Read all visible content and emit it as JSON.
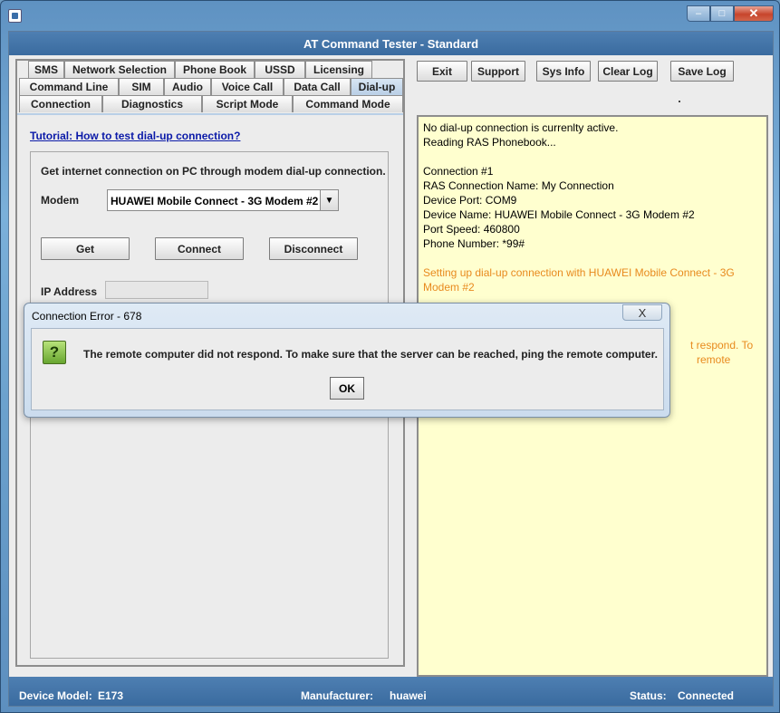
{
  "window": {
    "title": "AT Command Tester - Standard",
    "minimize_icon": "minimize-icon",
    "maximize_icon": "maximize-icon",
    "close_icon": "close-icon"
  },
  "tabs": {
    "row1": [
      "SMS",
      "Network Selection",
      "Phone Book",
      "USSD",
      "Licensing"
    ],
    "row2": [
      "Command Line",
      "SIM",
      "Audio",
      "Voice Call",
      "Data Call",
      "Dial-up"
    ],
    "row3": [
      "Connection",
      "Diagnostics",
      "Script Mode",
      "Command Mode"
    ],
    "active": "Dial-up"
  },
  "dialup": {
    "tutorial_link": "Tutorial: How to test dial-up connection?",
    "description": "Get internet connection on PC through modem dial-up connection.",
    "modem_label": "Modem",
    "modem_value": "HUAWEI Mobile Connect - 3G Modem #2",
    "get_button": "Get",
    "connect_button": "Connect",
    "disconnect_button": "Disconnect",
    "ip_label": "IP Address",
    "ip_value": ""
  },
  "toolbar": {
    "exit": "Exit",
    "support": "Support",
    "sysinfo": "Sys Info",
    "clearlog": "Clear Log",
    "savelog": "Save Log"
  },
  "log": {
    "lines": [
      {
        "text": "No dial-up connection is currenlty active.",
        "color": "#000000"
      },
      {
        "text": "Reading RAS Phonebook...",
        "color": "#000000"
      },
      {
        "text": "",
        "color": "#000000"
      },
      {
        "text": "Connection #1",
        "color": "#000000"
      },
      {
        "text": "RAS Connection Name: My Connection",
        "color": "#000000"
      },
      {
        "text": "Device Port: COM9",
        "color": "#000000"
      },
      {
        "text": "Device Name: HUAWEI Mobile Connect - 3G Modem #2",
        "color": "#000000"
      },
      {
        "text": "Port Speed: 460800",
        "color": "#000000"
      },
      {
        "text": "Phone Number: *99#",
        "color": "#000000"
      },
      {
        "text": "",
        "color": "#000000"
      },
      {
        "text": "Setting up dial-up connection with HUAWEI Mobile Connect - 3G Modem #2",
        "color": "#e88a1e"
      }
    ],
    "hidden_line_a": "t respond. To",
    "hidden_line_b": "remote"
  },
  "status": {
    "device_model_label": "Device Model:",
    "device_model_value": "E173",
    "manufacturer_label": "Manufacturer:",
    "manufacturer_value": "huawei",
    "status_label": "Status:",
    "status_value": "Connected"
  },
  "dialog": {
    "title": "Connection Error - 678",
    "message": "The remote computer did not respond. To make sure that the server can be reached, ping the remote computer.",
    "ok": "OK",
    "icon": "question-icon",
    "close_glyph": "X"
  }
}
